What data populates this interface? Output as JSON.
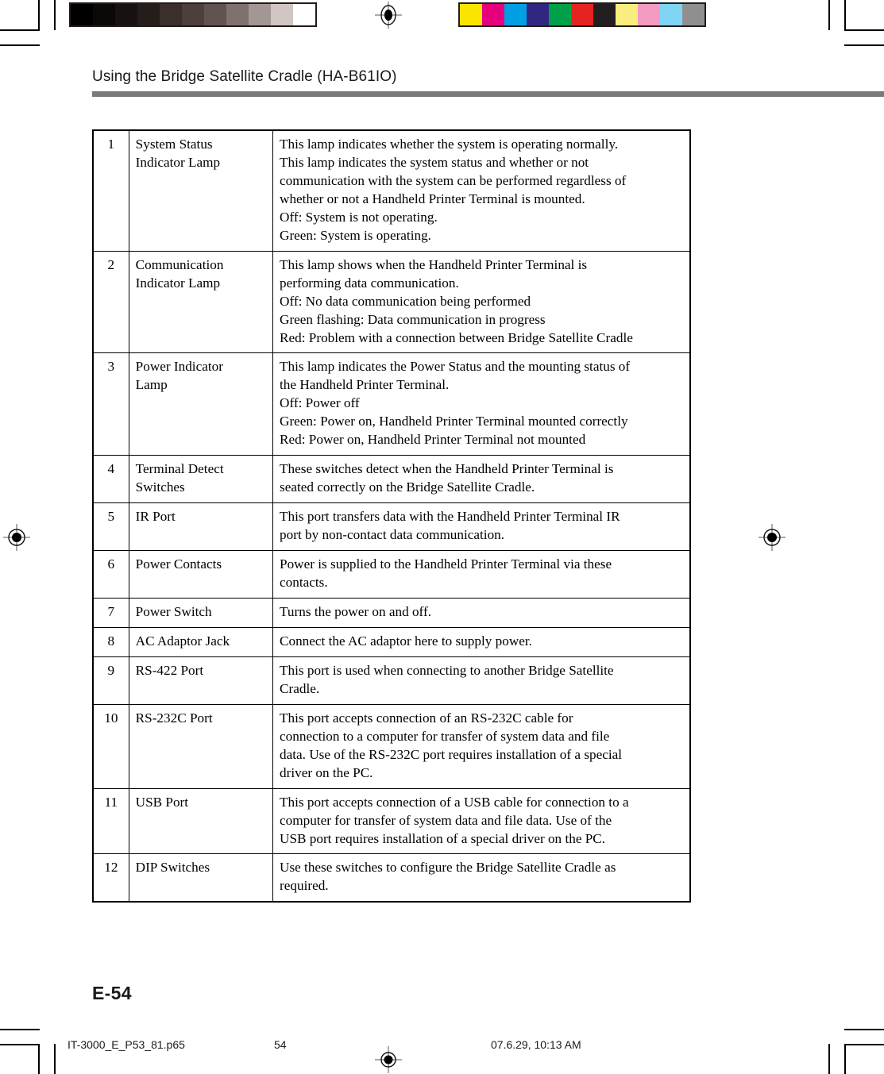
{
  "print_marks": {
    "gray_strip": {
      "name": "grayscale-calibration-strip",
      "swatches": [
        "#000000",
        "#0b0908",
        "#171210",
        "#241d1a",
        "#3a2f2b",
        "#4d403c",
        "#615350",
        "#7f716e",
        "#a39795",
        "#d1c6c3",
        "#ffffff"
      ]
    },
    "color_strip": {
      "name": "color-calibration-strip",
      "swatches": [
        "#fbe500",
        "#e6007e",
        "#009fe3",
        "#312783",
        "#00a04b",
        "#e52421",
        "#231f20",
        "#faed7f",
        "#f49ac1",
        "#7fd4f4",
        "#908f8f"
      ]
    },
    "registration_mark_label": "registration-target"
  },
  "header": {
    "section_title": "Using the Bridge Satellite Cradle (HA-B61IO)",
    "rule_color": "#7a7a7a"
  },
  "spec_table": {
    "rows": [
      {
        "num": "1",
        "name_lines": [
          "System Status",
          "Indicator Lamp"
        ],
        "desc_lines": [
          "This lamp indicates whether the system is operating normally.",
          "This lamp indicates the system status and whether or not",
          "communication with the system can be performed regardless of",
          "whether or not a Handheld Printer Terminal is mounted.",
          "Off: System is not operating.",
          "Green: System is operating."
        ]
      },
      {
        "num": "2",
        "name_lines": [
          "Communication",
          "Indicator Lamp"
        ],
        "desc_lines": [
          "This lamp shows when the Handheld Printer Terminal is",
          "performing data communication.",
          "Off: No data communication being performed",
          "Green flashing: Data communication in progress",
          "Red: Problem with a connection between Bridge Satellite Cradle"
        ]
      },
      {
        "num": "3",
        "name_lines": [
          "Power Indicator",
          "Lamp"
        ],
        "desc_lines": [
          "This lamp indicates the Power Status and the mounting status of",
          "the Handheld Printer Terminal.",
          "Off: Power off",
          "Green: Power on, Handheld Printer Terminal mounted correctly",
          "Red: Power on, Handheld Printer Terminal not mounted"
        ]
      },
      {
        "num": "4",
        "name_lines": [
          "Terminal Detect",
          "Switches"
        ],
        "desc_lines": [
          "These switches detect when the Handheld Printer Terminal is",
          "seated correctly on the Bridge Satellite Cradle."
        ]
      },
      {
        "num": "5",
        "name_lines": [
          "IR Port"
        ],
        "desc_lines": [
          "This port transfers data with the Handheld Printer Terminal IR",
          "port by non-contact data communication."
        ]
      },
      {
        "num": "6",
        "name_lines": [
          "Power Contacts"
        ],
        "desc_lines": [
          "Power is supplied to the Handheld Printer Terminal via these",
          "contacts."
        ]
      },
      {
        "num": "7",
        "name_lines": [
          "Power Switch"
        ],
        "desc_lines": [
          "Turns the power on and off."
        ]
      },
      {
        "num": "8",
        "name_lines": [
          "AC Adaptor Jack"
        ],
        "desc_lines": [
          "Connect the AC adaptor here to supply power."
        ]
      },
      {
        "num": "9",
        "name_lines": [
          "RS-422 Port"
        ],
        "desc_lines": [
          "This port is used when connecting to another Bridge Satellite",
          "Cradle."
        ]
      },
      {
        "num": "10",
        "name_lines": [
          "RS-232C Port"
        ],
        "desc_lines": [
          "This port accepts connection of an RS-232C cable for",
          "connection to a computer for transfer of system data and file",
          "data. Use of the RS-232C port requires installation of a special",
          "driver on the PC."
        ]
      },
      {
        "num": "11",
        "name_lines": [
          "USB Port"
        ],
        "desc_lines": [
          "This port accepts connection of a USB cable for connection to a",
          "computer for transfer of system data and file data. Use of the",
          "USB port requires installation of a special driver on the PC."
        ]
      },
      {
        "num": "12",
        "name_lines": [
          "DIP Switches"
        ],
        "desc_lines": [
          "Use these switches to configure the Bridge Satellite Cradle as",
          "required."
        ]
      }
    ]
  },
  "footer": {
    "page_label": "E-54",
    "filename": "IT-3000_E_P53_81.p65",
    "page_number": "54",
    "timestamp": "07.6.29, 10:13 AM"
  }
}
